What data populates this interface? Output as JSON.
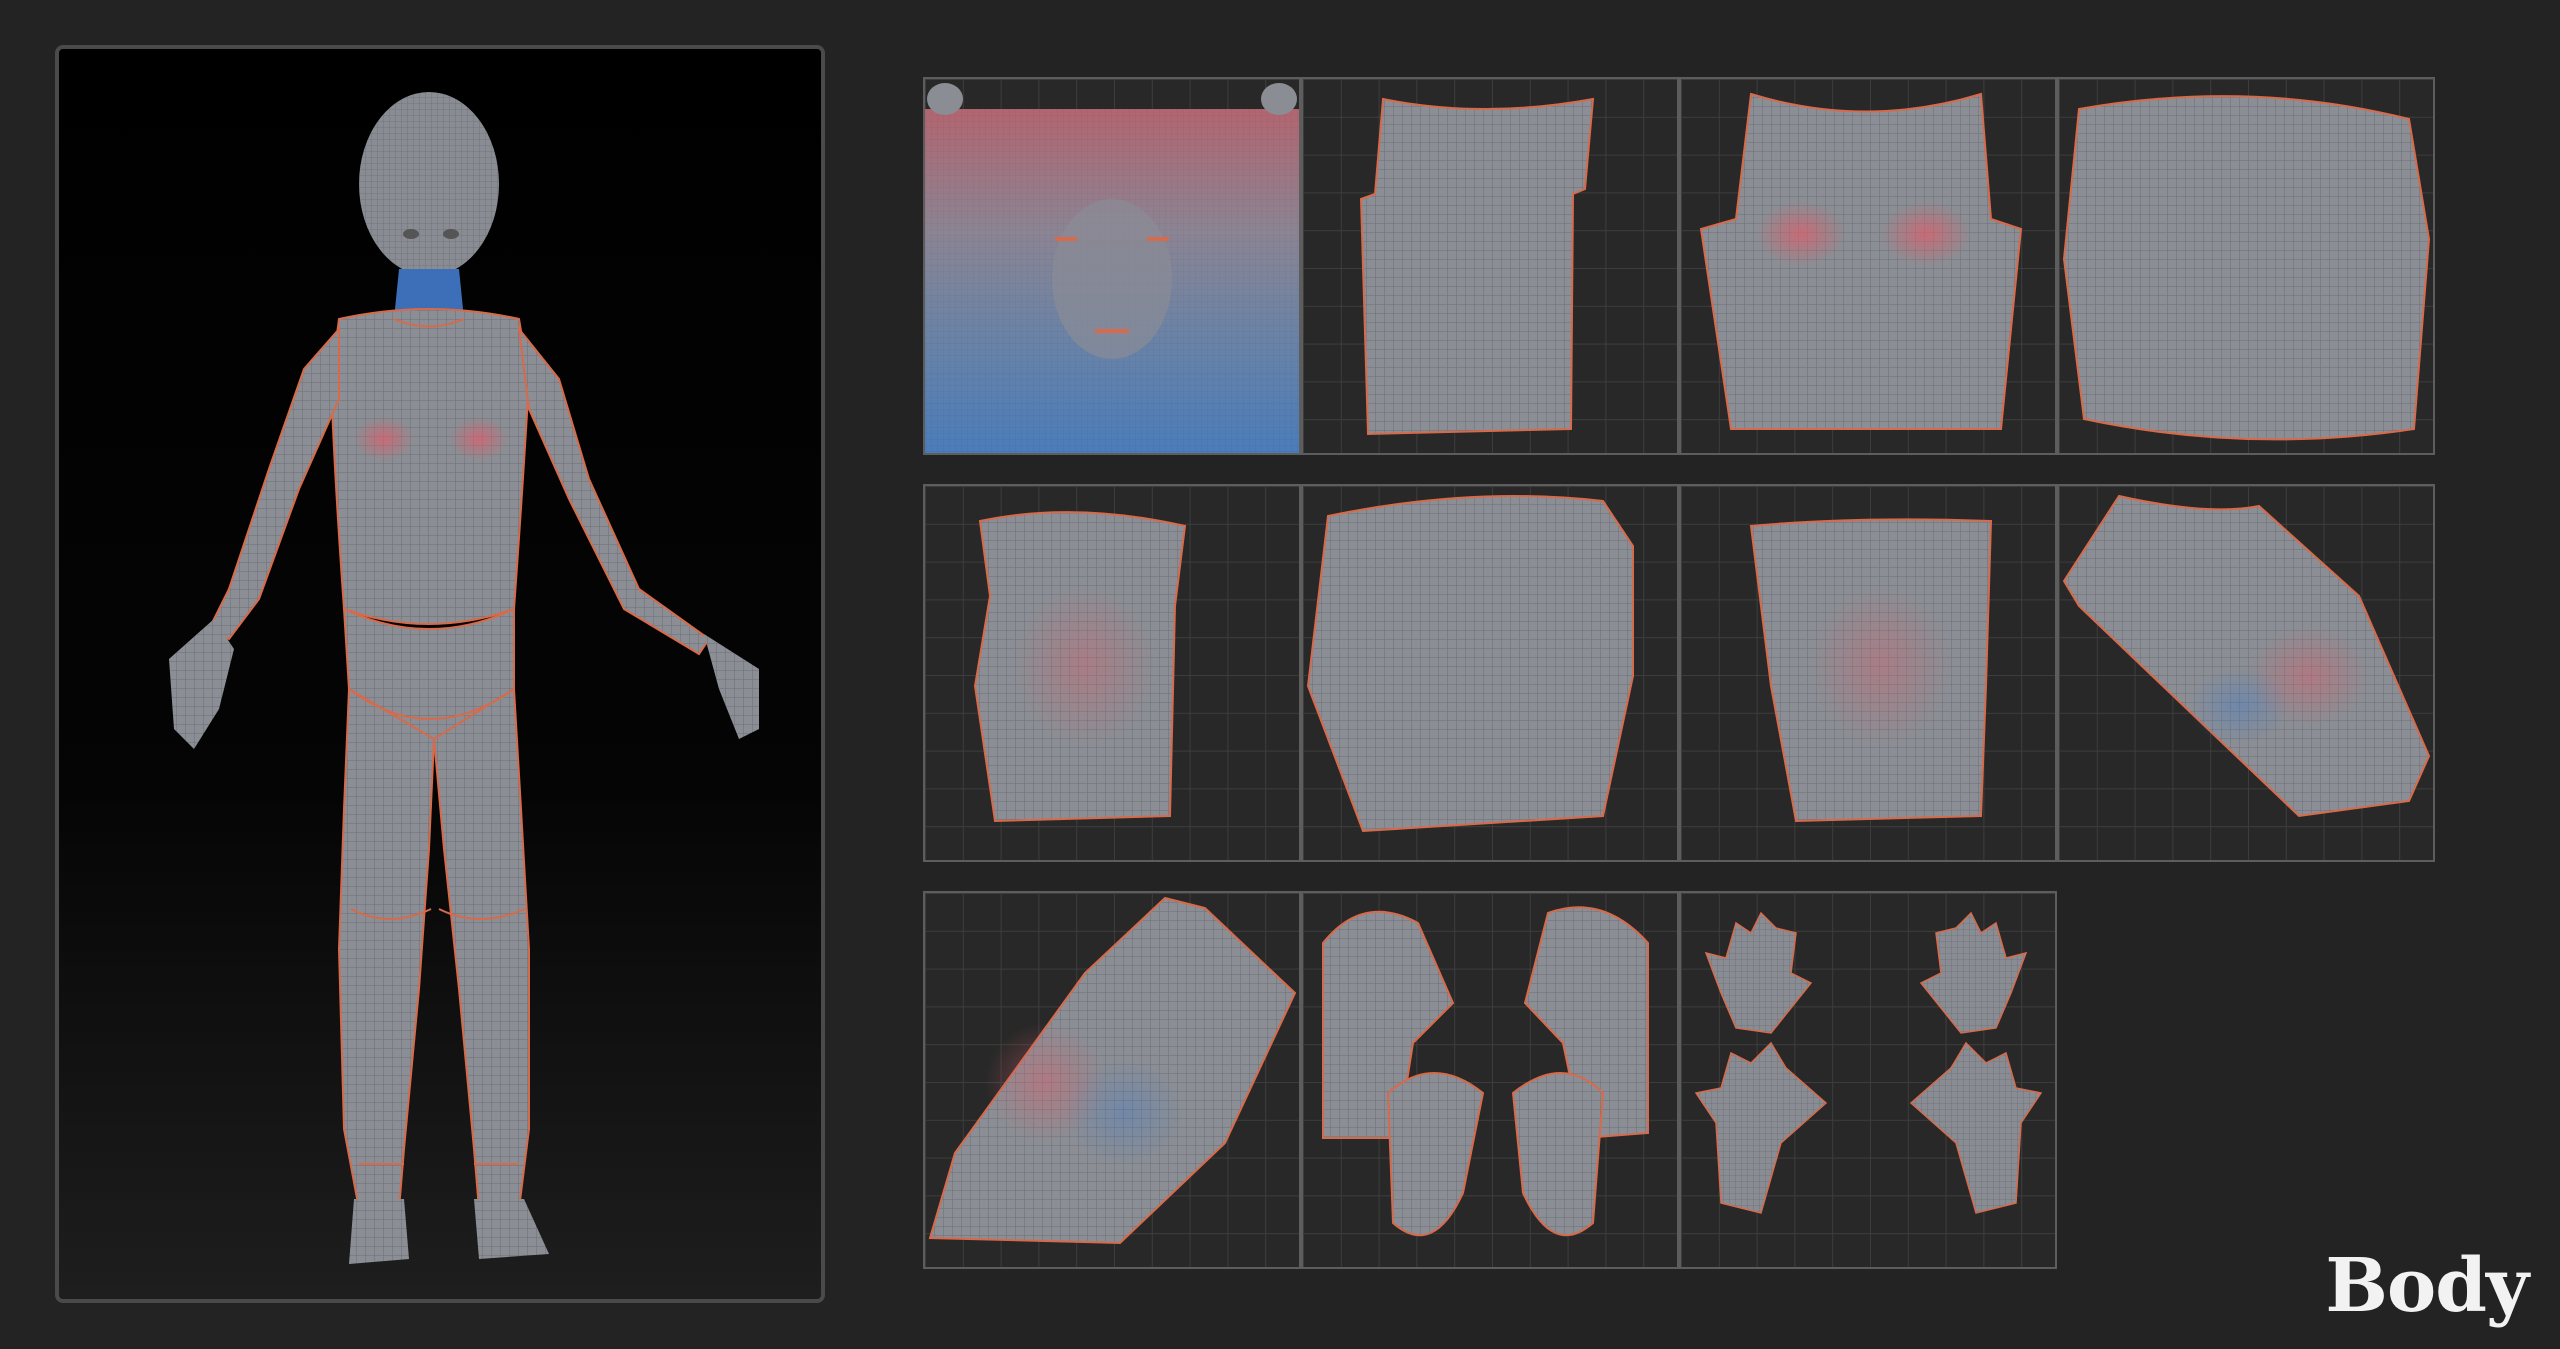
{
  "caption": {
    "text": "Body"
  },
  "colors": {
    "background": "#232323",
    "mesh": "#8a8d93",
    "wire": "#6e7178",
    "seam": "#d76a4a",
    "warm_stretch": "#d05a66",
    "cool_stretch": "#3d7ac8"
  },
  "uv_tiles": [
    {
      "id": "head",
      "content": "face-unwrap"
    },
    {
      "id": "torso-front-a",
      "content": "shirt-shell"
    },
    {
      "id": "torso-front-b",
      "content": "shirt-shell-chest"
    },
    {
      "id": "torso-back",
      "content": "back-panel"
    },
    {
      "id": "hip-left",
      "content": "hip-shell"
    },
    {
      "id": "pelvis",
      "content": "pelvis-shell"
    },
    {
      "id": "hip-right",
      "content": "hip-shell"
    },
    {
      "id": "leg-upper",
      "content": "leg-shell"
    },
    {
      "id": "leg-lower",
      "content": "leg-shell"
    },
    {
      "id": "feet",
      "content": "feet-shells"
    },
    {
      "id": "hands",
      "content": "hand-shells"
    }
  ]
}
